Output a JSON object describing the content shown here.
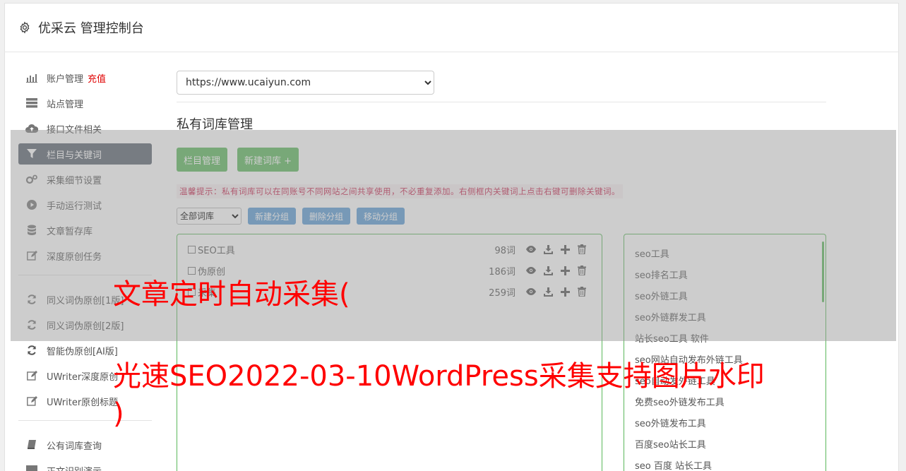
{
  "app": {
    "title": "优采云 管理控制台",
    "icon": "gear-icon"
  },
  "sidebar": {
    "items": [
      {
        "label": "账户管理",
        "extra": "充值",
        "icon": "bar-chart-icon"
      },
      {
        "label": "站点管理",
        "icon": "server-icon"
      },
      {
        "label": "接口文件相关",
        "icon": "cloud-upload-icon"
      },
      {
        "label": "栏目与关键词",
        "icon": "filter-icon",
        "active": true
      },
      {
        "label": "采集细节设置",
        "icon": "gears-icon"
      },
      {
        "label": "手动运行测试",
        "icon": "play-circle-icon"
      },
      {
        "label": "文章暂存库",
        "icon": "database-icon"
      },
      {
        "label": "深度原创任务",
        "icon": "edit-icon"
      },
      {
        "label": "同义词伪原创[1版]",
        "icon": "refresh-icon"
      },
      {
        "label": "同义词伪原创[2版]",
        "icon": "refresh-icon"
      },
      {
        "label": "智能伪原创[AI版]",
        "icon": "refresh-icon"
      },
      {
        "label": "UWriter深度原创",
        "icon": "edit-icon"
      },
      {
        "label": "UWriter原创标题",
        "icon": "edit-icon"
      },
      {
        "label": "公有词库查询",
        "icon": "book-icon"
      },
      {
        "label": "正文识别演示",
        "icon": "monitor-icon"
      }
    ]
  },
  "main": {
    "site_select": "https://www.ucaiyun.com",
    "section_title": "私有词库管理",
    "buttons": {
      "column": "栏目管理",
      "new_lib": "新建词库 +"
    },
    "tip": "温馨提示：私有词库可以在同账号不同网站之间共享使用，不必重复添加。右侧框内关键词上点击右键可删除关键词。",
    "filter": {
      "select": "全部词库",
      "new_group": "新建分组",
      "delete_group": "删除分组",
      "move_group": "移动分组"
    },
    "libraries": [
      {
        "name": "SEO工具",
        "count": "98词"
      },
      {
        "name": "伪原创",
        "count": "186词"
      },
      {
        "name": "采集",
        "count": "259词"
      }
    ],
    "keywords": [
      "seo工具",
      "seo排名工具",
      "seo外链工具",
      "seo外链群发工具",
      "站长seo工具 软件",
      "seo网站自动发布外链工具",
      "seo自动发外链工具",
      "免费seo外链发布工具",
      "seo外链发布工具",
      "百度seo站长工具",
      "seo 百度 站长工具"
    ]
  },
  "overlay": {
    "line1": "文章定时自动采集(",
    "line2": "光速SEO2022-03-10WordPress采集支持图片水印",
    "line3": ")"
  },
  "colors": {
    "accent_green": "#5cb85c",
    "accent_blue": "#5b9bd5",
    "active_nav": "#5b6470",
    "overlay_text": "#ff0000"
  }
}
